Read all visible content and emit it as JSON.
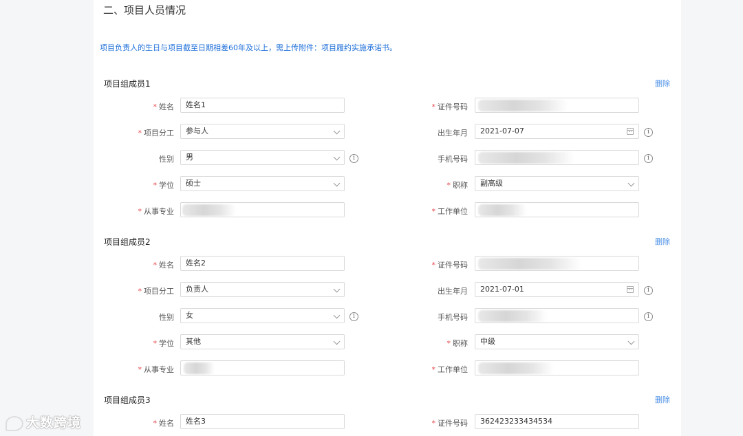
{
  "section": {
    "title": "二、项目人员情况"
  },
  "notice": "项目负责人的生日与项目截至日期相差60年及以上，需上传附件：项目履约实施承诺书。",
  "labels": {
    "name": "姓名",
    "id_number": "证件号码",
    "division": "项目分工",
    "birth": "出生年月",
    "gender": "性别",
    "phone": "手机号码",
    "degree": "学位",
    "title": "职称",
    "major": "从事专业",
    "employer": "工作单位",
    "delete": "删除",
    "info_icon": "i"
  },
  "members": [
    {
      "title": "项目组成员1",
      "name": "姓名1",
      "division": "参与人",
      "birth": "2021-07-07",
      "gender": "男",
      "degree": "硕士",
      "title_rank": "副高级"
    },
    {
      "title": "项目组成员2",
      "name": "姓名2",
      "division": "负责人",
      "birth": "2021-07-01",
      "gender": "女",
      "degree": "其他",
      "title_rank": "中级"
    },
    {
      "title": "项目组成员3",
      "name": "姓名3",
      "id_number": "362423233434534"
    }
  ],
  "watermark": "大数跨境",
  "colors": {
    "accent": "#1e6fd9",
    "required": "#e5484d",
    "link": "#4a8fe7"
  }
}
